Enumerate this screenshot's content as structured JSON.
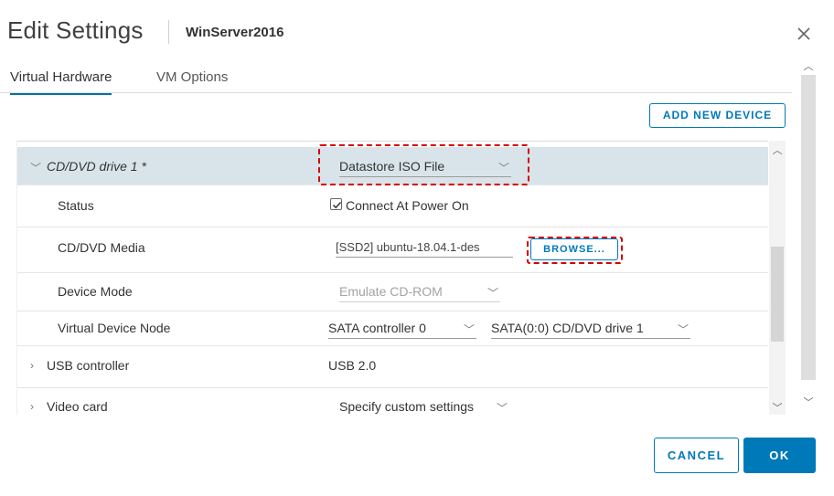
{
  "header": {
    "title": "Edit Settings",
    "vm_name": "WinServer2016"
  },
  "tabs": [
    {
      "label": "Virtual Hardware",
      "active": true
    },
    {
      "label": "VM Options",
      "active": false
    }
  ],
  "toolbar": {
    "add_device_label": "ADD NEW DEVICE"
  },
  "cd_dvd": {
    "group_label": "CD/DVD drive 1 *",
    "source_value": "Datastore ISO File",
    "status_label": "Status",
    "connect_label": "Connect At Power On",
    "connect_checked": true,
    "media_label": "CD/DVD Media",
    "media_value": "[SSD2] ubuntu-18.04.1-des",
    "browse_label": "BROWSE...",
    "device_mode_label": "Device Mode",
    "device_mode_value": "Emulate CD-ROM",
    "node_label": "Virtual Device Node",
    "controller_value": "SATA controller 0",
    "node_value": "SATA(0:0) CD/DVD drive 1"
  },
  "usb": {
    "label": "USB controller",
    "value": "USB 2.0"
  },
  "video": {
    "label": "Video card",
    "value": "Specify custom settings"
  },
  "footer": {
    "cancel_label": "CANCEL",
    "ok_label": "OK"
  },
  "colors": {
    "accent": "#0079b8",
    "highlight_row": "#d9e4ea",
    "annotation_red": "#d40000"
  }
}
